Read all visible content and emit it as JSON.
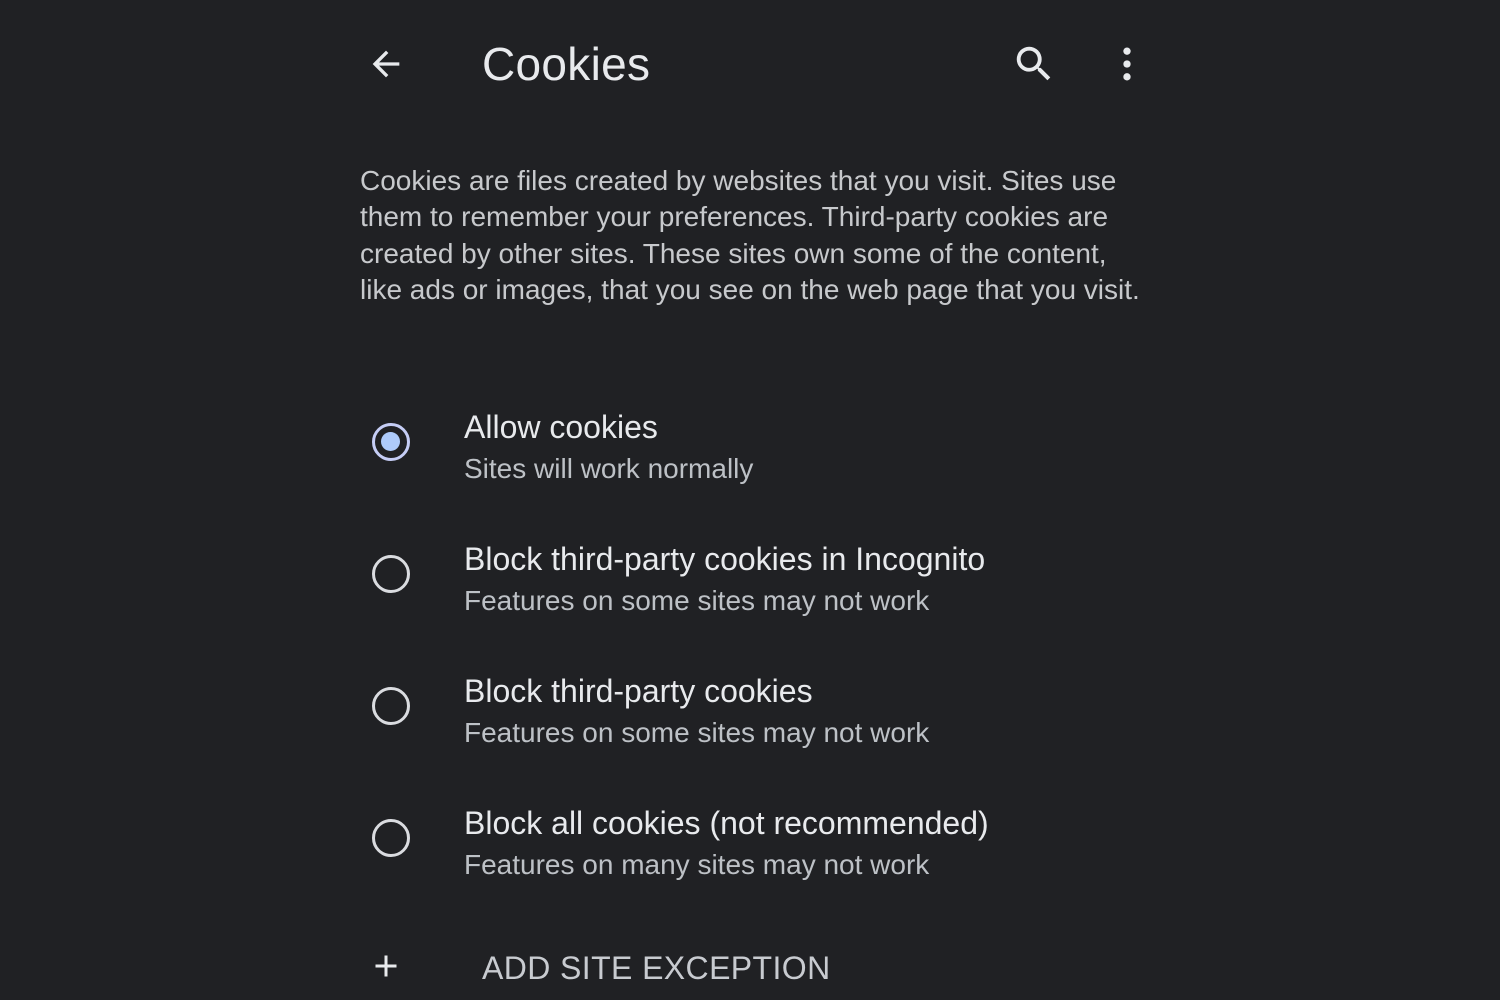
{
  "header": {
    "title": "Cookies",
    "back_icon": "arrow-back-icon",
    "search_icon": "search-icon",
    "more_icon": "more-vert-icon"
  },
  "description": "Cookies are files created by websites that you visit. Sites use them to remember your preferences. Third-party cookies are created by other sites. These sites own some of the content, like ads or images, that you see on the web page that you visit.",
  "options": [
    {
      "title": "Allow cookies",
      "subtitle": "Sites will work normally",
      "selected": true
    },
    {
      "title": "Block third-party cookies in Incognito",
      "subtitle": "Features on some sites may not work",
      "selected": false
    },
    {
      "title": "Block third-party cookies",
      "subtitle": "Features on some sites may not work",
      "selected": false
    },
    {
      "title": "Block all cookies (not recommended)",
      "subtitle": "Features on many sites may not work",
      "selected": false
    }
  ],
  "add_exception": {
    "label": "ADD SITE EXCEPTION",
    "icon": "plus-icon"
  },
  "colors": {
    "background": "#202124",
    "text_primary": "#e8eaed",
    "text_secondary": "#bdc1c6",
    "radio_selected": "#aecbfa"
  }
}
